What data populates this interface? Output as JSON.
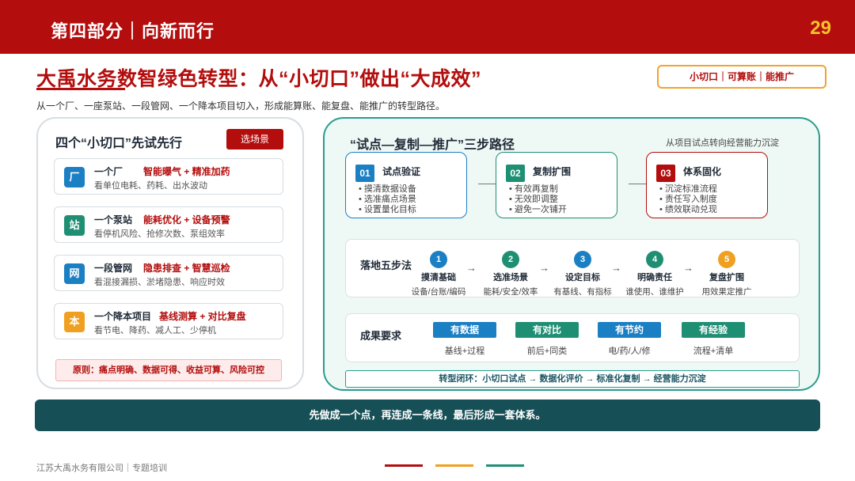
{
  "header": {
    "section": "第四部分｜向新而行",
    "page_number": "29"
  },
  "title": "大禹水务数智绿色转型：从“小切口”做出“大成效”",
  "subtitle": "从一个厂、一座泵站、一段管网、一个降本项目切入，形成能算账、能复盘、能推广的转型路径。",
  "tag": "小切口｜可算账｜能推广",
  "left": {
    "title": "四个“小切口”先试先行",
    "button": "选场景",
    "cards": [
      {
        "badge": "厂",
        "name": "一个厂",
        "highlight": "智能曝气 + 精准加药",
        "desc": "看单位电耗、药耗、出水波动",
        "color": "#1b7fc4"
      },
      {
        "badge": "站",
        "name": "一个泵站",
        "highlight": "能耗优化 + 设备预警",
        "desc": "看停机风险、抢修次数、泵组效率",
        "color": "#1f8f74"
      },
      {
        "badge": "网",
        "name": "一段管网",
        "highlight": "隐患排查 + 智慧巡检",
        "desc": "看混接漏损、淤堵隐患、响应时效",
        "color": "#1b7fc4"
      },
      {
        "badge": "本",
        "name": "一个降本项目",
        "highlight": "基线测算 + 对比复盘",
        "desc": "看节电、降药、减人工、少停机",
        "color": "#f0a020"
      }
    ],
    "principle": "原则：痛点明确、数据可得、收益可算、风险可控"
  },
  "right": {
    "title": "“试点—复制—推广”三步路径",
    "note": "从项目试点转向经营能力沉淀",
    "steps": [
      {
        "num": "01",
        "title": "试点验证",
        "items": [
          "摸清数据设备",
          "选准痛点场景",
          "设置量化目标"
        ],
        "color": "#1b7fc4"
      },
      {
        "num": "02",
        "title": "复制扩围",
        "items": [
          "有效再复制",
          "无效即调整",
          "避免一次铺开"
        ],
        "color": "#1f8f74"
      },
      {
        "num": "03",
        "title": "体系固化",
        "items": [
          "沉淀标准流程",
          "责任写入制度",
          "绩效联动兑现"
        ],
        "color": "#b30d0d"
      }
    ],
    "five": {
      "label": "落地五步法",
      "steps": [
        {
          "n": "1",
          "name": "摸清基础",
          "desc": "设备/台账/编码",
          "color": "#1b7fc4"
        },
        {
          "n": "2",
          "name": "选准场景",
          "desc": "能耗/安全/效率",
          "color": "#1f8f74"
        },
        {
          "n": "3",
          "name": "设定目标",
          "desc": "有基线、有指标",
          "color": "#1b7fc4"
        },
        {
          "n": "4",
          "name": "明确责任",
          "desc": "谁使用、谁维护",
          "color": "#1f8f74"
        },
        {
          "n": "5",
          "name": "复盘扩围",
          "desc": "用效果定推广",
          "color": "#f0a020"
        }
      ],
      "arrow": "→"
    },
    "results": {
      "label": "成果要求",
      "items": [
        {
          "name": "有数据",
          "desc": "基线+过程",
          "color": "#1b7fc4"
        },
        {
          "name": "有对比",
          "desc": "前后+同类",
          "color": "#1f8f74"
        },
        {
          "name": "有节约",
          "desc": "电/药/人/修",
          "color": "#1b7fc4"
        },
        {
          "name": "有经验",
          "desc": "流程+清单",
          "color": "#1f8f74"
        }
      ]
    },
    "loop": "转型闭环：小切口试点 → 数据化评价 → 标准化复制 → 经营能力沉淀"
  },
  "banner": "先做成一个点，再连成一条线，最后形成一套体系。",
  "footer": "江苏大禹水务有限公司｜专题培训",
  "footer_lines": [
    "#b30d0d",
    "#f0a020",
    "#1f8f74"
  ]
}
